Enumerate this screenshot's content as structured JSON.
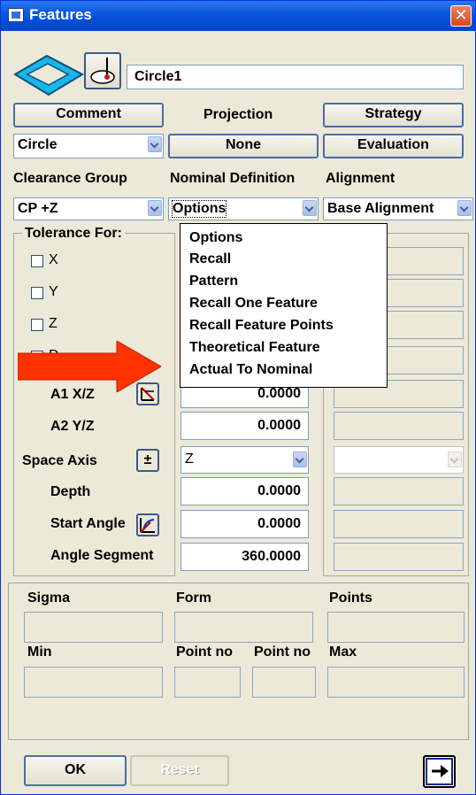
{
  "window": {
    "title": "Features",
    "close_glyph": "✕"
  },
  "feature_name": "Circle1",
  "buttons": {
    "comment": "Comment",
    "projection": "Projection",
    "strategy": "Strategy",
    "projection_value": "None",
    "evaluation": "Evaluation",
    "ok": "OK",
    "reset": "Reset"
  },
  "feature_type": "Circle",
  "headers": {
    "clearance_group": "Clearance Group",
    "nominal_definition": "Nominal Definition",
    "alignment": "Alignment"
  },
  "combos": {
    "clearance_group": "CP +Z",
    "nominal_definition": "Options",
    "alignment": "Base Alignment",
    "space_axis": "Z",
    "space_axis_2": ""
  },
  "tolerance": {
    "legend": "Tolerance For:",
    "checkboxes": [
      {
        "label": "X"
      },
      {
        "label": "Y"
      },
      {
        "label": "Z"
      },
      {
        "label": "D"
      }
    ]
  },
  "params": {
    "a1_label": "A1 X/Z",
    "a1_value": "0.0000",
    "a2_label": "A2 Y/Z",
    "a2_value": "0.0000",
    "space_axis_label": "Space Axis",
    "space_axis_btn": "±",
    "depth_label": "Depth",
    "depth_value": "0.0000",
    "start_angle_label": "Start Angle",
    "start_angle_value": "0.0000",
    "angle_segment_label": "Angle Segment",
    "angle_segment_value": "360.0000"
  },
  "results": {
    "sigma": "Sigma",
    "form": "Form",
    "points": "Points",
    "min": "Min",
    "point_no_1": "Point no",
    "point_no_2": "Point no",
    "max": "Max"
  },
  "dropdown_items": [
    "Options",
    "Recall",
    "Pattern",
    "Recall One Feature",
    "Recall Feature Points",
    "Theoretical Feature",
    "Actual To Nominal"
  ],
  "annotation_arrow_color": "#ff3300",
  "icons": [
    "features-window-icon",
    "close-icon",
    "circle-feature-icon",
    "probe-icon",
    "angle-icon",
    "plus-minus-icon",
    "start-angle-icon",
    "next-arrow-icon"
  ]
}
